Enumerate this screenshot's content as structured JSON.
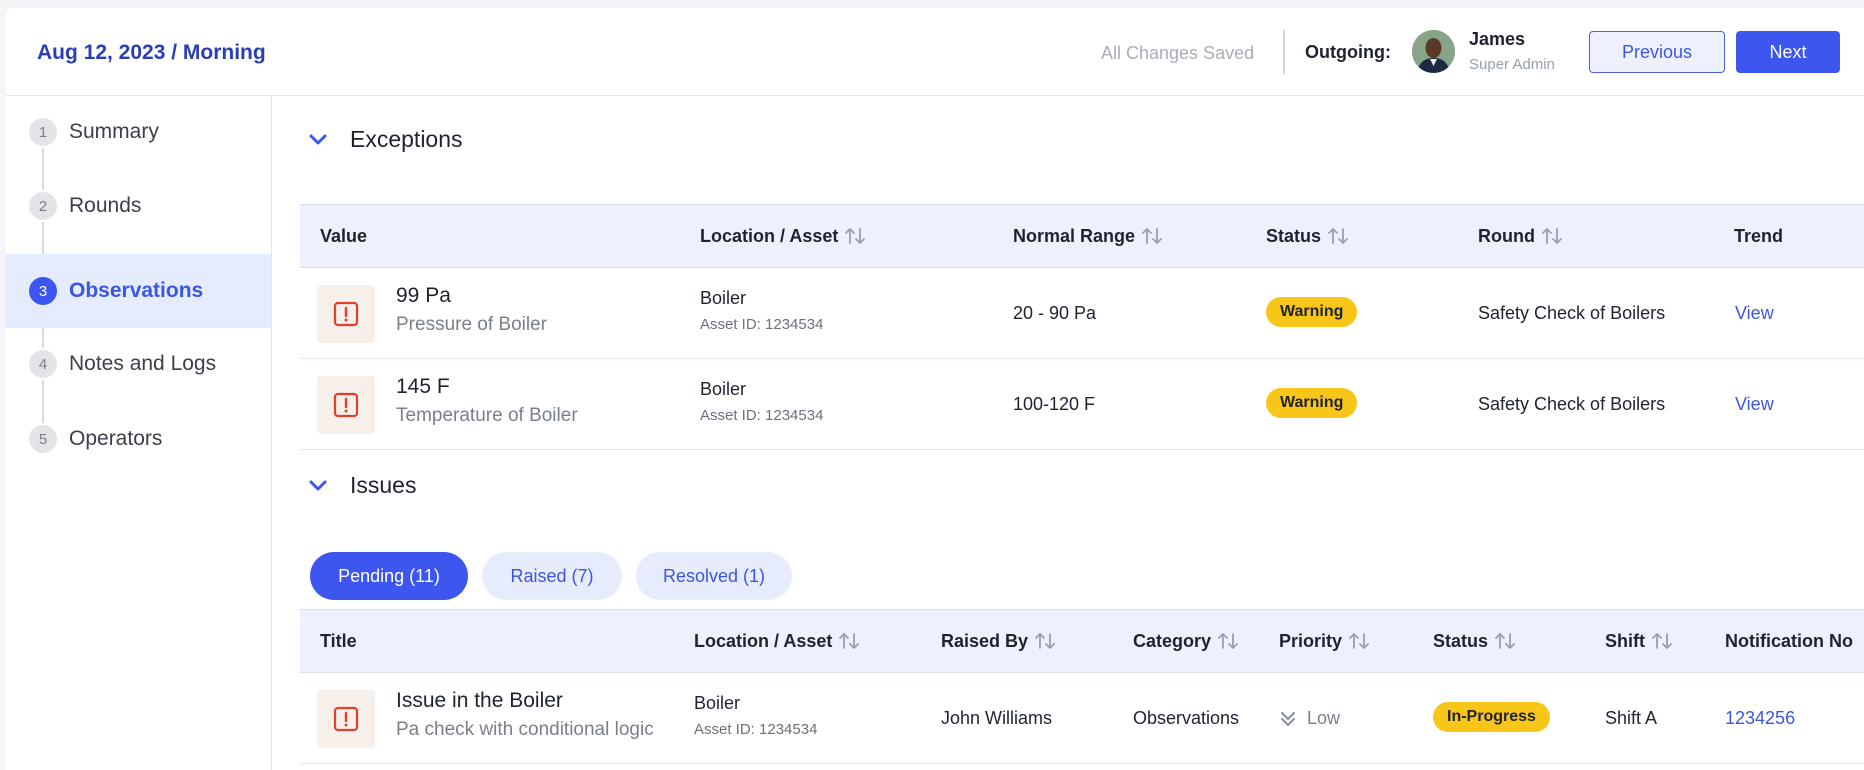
{
  "header": {
    "date_shift": "Aug 12, 2023 / Morning",
    "save_status": "All Changes Saved",
    "outgoing_label": "Outgoing:",
    "user": {
      "name": "James",
      "role": "Super Admin"
    },
    "previous_label": "Previous",
    "next_label": "Next"
  },
  "sidebar": {
    "steps": [
      {
        "num": "1",
        "label": "Summary",
        "active": false
      },
      {
        "num": "2",
        "label": "Rounds",
        "active": false
      },
      {
        "num": "3",
        "label": "Observations",
        "active": true
      },
      {
        "num": "4",
        "label": "Notes and Logs",
        "active": false
      },
      {
        "num": "5",
        "label": "Operators",
        "active": false
      }
    ]
  },
  "exceptions": {
    "title": "Exceptions",
    "columns": [
      "Value",
      "Location / Asset",
      "Normal Range",
      "Status",
      "Round",
      "Trend"
    ],
    "rows": [
      {
        "value": "99 Pa",
        "value_desc": "Pressure of Boiler",
        "location": "Boiler",
        "asset_id": "Asset ID: 1234534",
        "range": "20 - 90 Pa",
        "status": "Warning",
        "round": "Safety Check of  Boilers",
        "trend": "View"
      },
      {
        "value": "145 F",
        "value_desc": "Temperature of Boiler",
        "location": "Boiler",
        "asset_id": "Asset ID: 1234534",
        "range": "100-120 F",
        "status": "Warning",
        "round": "Safety Check of Boilers",
        "trend": "View"
      }
    ]
  },
  "issues": {
    "title": "Issues",
    "tabs": [
      {
        "label": "Pending (11)",
        "active": true
      },
      {
        "label": "Raised (7)",
        "active": false
      },
      {
        "label": "Resolved (1)",
        "active": false
      }
    ],
    "columns": [
      "Title",
      "Location / Asset",
      "Raised By",
      "Category",
      "Priority",
      "Status",
      "Shift",
      "Notification No"
    ],
    "rows": [
      {
        "title": "Issue in the Boiler",
        "desc": "Pa check with conditional logic",
        "location": "Boiler",
        "asset_id": "Asset ID: 1234534",
        "raised_by": "John Williams",
        "category": "Observations",
        "priority": "Low",
        "status": "In-Progress",
        "shift": "Shift A",
        "notification": "1234256"
      }
    ]
  },
  "colors": {
    "accent": "#3d56f0",
    "brand_text": "#2a3fb5",
    "warning": "#f7c618",
    "error_icon": "#e0412e"
  },
  "icons": [
    "chevron-down-icon",
    "sort-icon",
    "alert-icon",
    "priority-low-icon"
  ]
}
